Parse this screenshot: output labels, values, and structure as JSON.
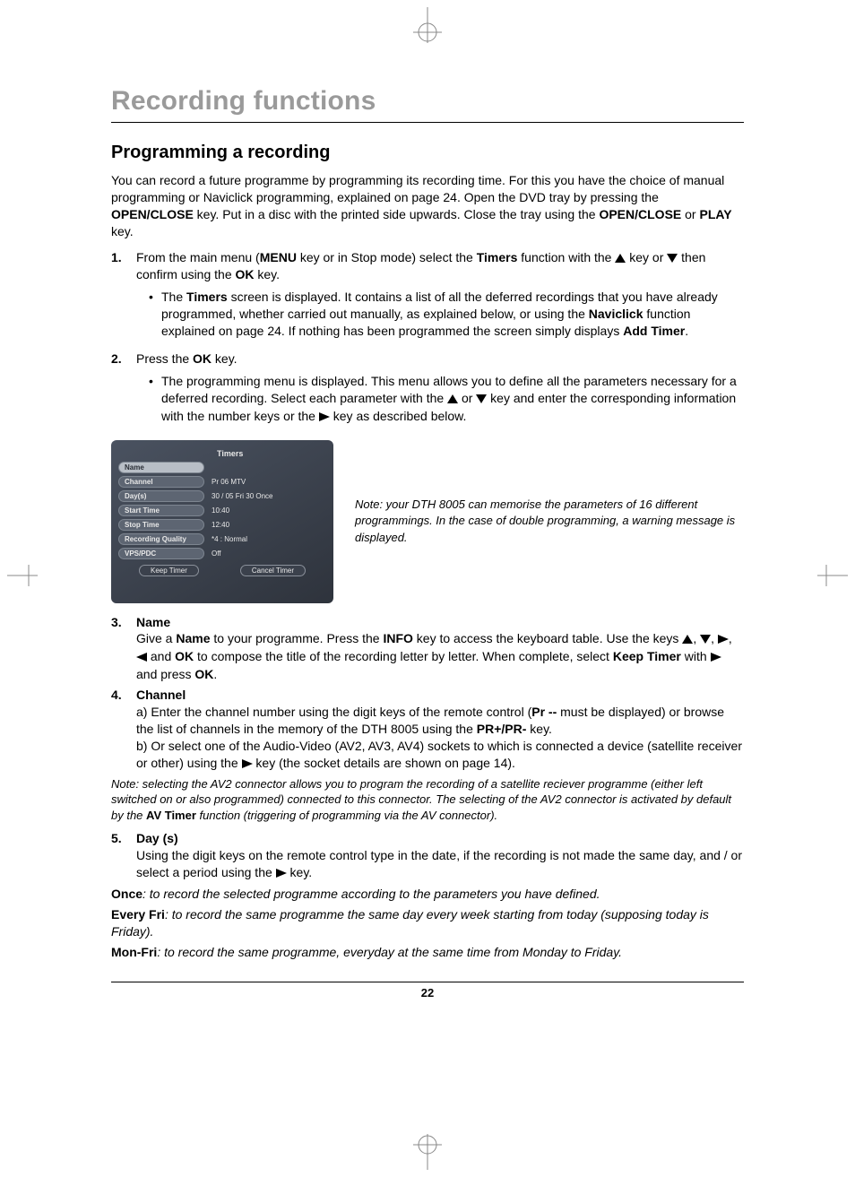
{
  "chapter_title": "Recording functions",
  "section_title": "Programming a recording",
  "intro": "You can record a future programme by programming its recording time. For this you have the choice of manual programming or Naviclick programming, explained on page 24. Open the DVD tray by pressing the OPEN/CLOSE key. Put in a disc with the printed side upwards. Close the tray using the OPEN/CLOSE or PLAY key.",
  "step1_num": "1.",
  "step1_a": "From the main menu (",
  "step1_menu": "MENU",
  "step1_b": " key or in Stop mode) select the ",
  "step1_timers": "Timers",
  "step1_c": " function with the ",
  "step1_d": " key or ",
  "step1_e": " then confirm using the ",
  "step1_ok": "OK",
  "step1_f": " key.",
  "step1_bullet_a": "The ",
  "step1_bullet_timers": "Timers",
  "step1_bullet_b": " screen is displayed. It contains a list of all the deferred recordings that you have already programmed, whether carried out manually, as explained below, or using the ",
  "step1_bullet_navi": "Naviclick",
  "step1_bullet_c": " function explained on page 24. If nothing has been programmed the screen simply displays ",
  "step1_bullet_add": "Add Timer",
  "step1_bullet_d": ".",
  "step2_num": "2.",
  "step2_a": "Press the ",
  "step2_ok": "OK",
  "step2_b": " key.",
  "step2_bullet_a": "The programming menu is displayed. This menu allows you to define all the parameters necessary for a deferred recording. Select each parameter with the ",
  "step2_bullet_b": " or ",
  "step2_bullet_c": " key and enter the corresponding information with the number keys or the ",
  "step2_bullet_d": " key as described below.",
  "screenshot": {
    "title": "Timers",
    "rows": [
      {
        "label": "Name",
        "value": ""
      },
      {
        "label": "Channel",
        "value": "Pr  06    MTV"
      },
      {
        "label": "Day(s)",
        "value": "30 / 05   Fri   30   Once"
      },
      {
        "label": "Start Time",
        "value": "10:40"
      },
      {
        "label": "Stop Time",
        "value": "12:40"
      },
      {
        "label": "Recording Quality",
        "value": "*4 : Normal"
      },
      {
        "label": "VPS/PDC",
        "value": "Off"
      }
    ],
    "button_keep": "Keep Timer",
    "button_cancel": "Cancel Timer"
  },
  "fig_note": "Note: your DTH 8005 can memorise the parameters of 16 different programmings. In the case of double programming, a warning message is displayed.",
  "step3_num": "3.",
  "step3_head": "Name",
  "step3_a": "Give a ",
  "step3_name": "Name",
  "step3_b": " to your programme. Press the ",
  "step3_info": "INFO",
  "step3_c": " key to access the keyboard table. Use the keys ",
  "step3_d": ", ",
  "step3_e": ", ",
  "step3_f": ", ",
  "step3_g": " and ",
  "step3_ok": "OK",
  "step3_h": " to compose the title of the recording letter by letter. When complete, select ",
  "step3_keep": "Keep Timer",
  "step3_i": " with ",
  "step3_j": " and press ",
  "step3_ok2": "OK",
  "step3_k": ".",
  "step4_num": "4.",
  "step4_head": "Channel",
  "step4_line1_a": "a) Enter the channel number using the digit keys of the remote control (",
  "step4_pr": "Pr --",
  "step4_line1_b": " must be displayed) or browse the list of channels in the memory of the DTH 8005 using the ",
  "step4_prpm": "PR+/PR-",
  "step4_line1_c": " key.",
  "step4_line2_a": "b) Or select one of the Audio-Video (AV2, AV3, AV4) sockets to which is connected a device (satellite receiver or other) using the ",
  "step4_line2_b": " key (the socket details are shown on page 14).",
  "step4_note_a": "Note: selecting the AV2 connector allows you to program the recording of a satellite reciever programme (either left switched on or also programmed) connected to this connector. The selecting of the AV2 connector is activated by default by the ",
  "step4_note_av": "AV Timer",
  "step4_note_b": " function (triggering of programming via the AV connector).",
  "step5_num": "5.",
  "step5_head": "Day (s)",
  "step5_a": "Using the digit keys on the remote control type in the date, if the recording is not made the same day, and / or select a period using the ",
  "step5_b": " key.",
  "def_once_term": "Once",
  "def_once_desc": ": to record the selected programme according to the parameters you have defined.",
  "def_every_term": "Every Fri",
  "def_every_desc": ": to record the same programme the same day every week starting from today (supposing today is Friday).",
  "def_monfri_term": "Mon-Fri",
  "def_monfri_desc": ": to record the same programme, everyday at the same time from Monday to Friday.",
  "page_number": "22"
}
